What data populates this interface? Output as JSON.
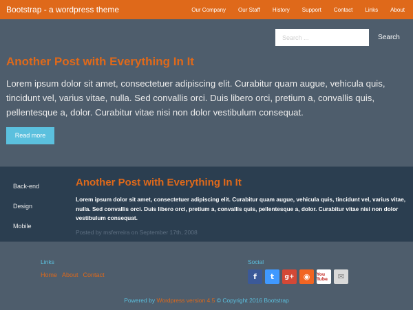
{
  "navbar": {
    "brand": "Bootstrap - a wordpress theme",
    "links": [
      "Our Company",
      "Our Staff",
      "History",
      "Support",
      "Contact",
      "Links",
      "About"
    ]
  },
  "search": {
    "placeholder": "Search ...",
    "button_label": "Search"
  },
  "hero_post": {
    "title": "Another Post with Everything In It",
    "body": "Lorem ipsum dolor sit amet, consectetuer adipiscing elit. Curabitur quam augue, vehicula quis, tincidunt vel, varius vitae, nulla. Sed convallis orci. Duis libero orci, pretium a, convallis quis, pellentesque a, dolor. Curabitur vitae nisi non dolor vestibulum consequat.",
    "read_more_label": "Read more"
  },
  "sidebar": {
    "items": [
      "Back-end",
      "Design",
      "Mobile"
    ]
  },
  "second_post": {
    "title": "Another Post with Everything In It",
    "body": "Lorem ipsum dolor sit amet, consectetuer adipiscing elit. Curabitur quam augue, vehicula quis, tincidunt vel, varius vitae, nulla. Sed convallis orci. Duis libero orci, pretium a, convallis quis, pellentesque a, dolor. Curabitur vitae nisi non dolor vestibulum consequat.",
    "meta": "Posted by msferreira on September 17th, 2008"
  },
  "footer": {
    "links_heading": "Links",
    "links": [
      "Home",
      "About",
      "Contact"
    ],
    "social_heading": "Social",
    "social_icons": [
      {
        "icon": "facebook-icon",
        "glyph": "f"
      },
      {
        "icon": "twitter-icon",
        "glyph": "t"
      },
      {
        "icon": "google-plus-icon",
        "glyph": "g+"
      },
      {
        "icon": "rss-icon",
        "glyph": "◉"
      },
      {
        "icon": "youtube-icon",
        "glyph": "You Tube"
      },
      {
        "icon": "email-icon",
        "glyph": "✉"
      }
    ],
    "copyright_powered": "Powered by",
    "copyright_wp": "Wordpress version 4.5",
    "copyright_rest": "© Copyright 2016 Bootstrap"
  },
  "colors": {
    "navbar_bg": "#df691a",
    "page_bg": "#4e5d6c",
    "band_bg": "#2b3e50",
    "accent": "#df691a",
    "info": "#5bc0de"
  }
}
